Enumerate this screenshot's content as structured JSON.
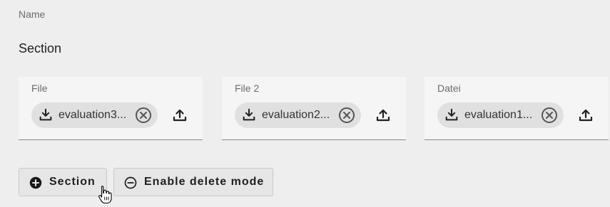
{
  "form": {
    "name_label": "Name",
    "section_title": "Section"
  },
  "files": [
    {
      "label": "File",
      "filename": "evaluation3..."
    },
    {
      "label": "File 2",
      "filename": "evaluation2..."
    },
    {
      "label": "Datei",
      "filename": "evaluation1..."
    }
  ],
  "actions": {
    "add_section_label": "Section",
    "delete_mode_label": "Enable delete mode"
  },
  "icons": {
    "download": "download-icon",
    "remove": "remove-circle-icon",
    "upload": "upload-icon",
    "add": "add-circle-icon",
    "minus": "minus-circle-icon",
    "cursor": "hand-pointer-cursor"
  },
  "colors": {
    "background": "#eeeeee",
    "card": "#f5f5f5",
    "chip": "#e0e0e0",
    "icon": "#212121"
  }
}
